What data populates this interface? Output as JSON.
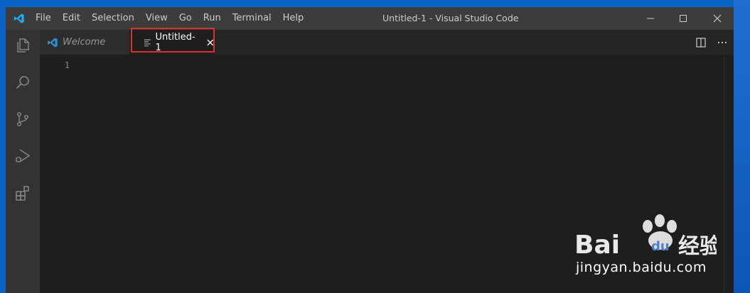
{
  "menu": [
    "File",
    "Edit",
    "Selection",
    "View",
    "Go",
    "Run",
    "Terminal",
    "Help"
  ],
  "window_title": "Untitled-1 - Visual Studio Code",
  "tabs": [
    {
      "label": "Welcome"
    },
    {
      "label": "Untitled-1"
    }
  ],
  "editor": {
    "line_numbers": [
      "1"
    ]
  },
  "watermark": {
    "url": "jingyan.baidu.com"
  },
  "colors": {
    "accent": "#007acc",
    "highlight_border": "#e0302e"
  }
}
